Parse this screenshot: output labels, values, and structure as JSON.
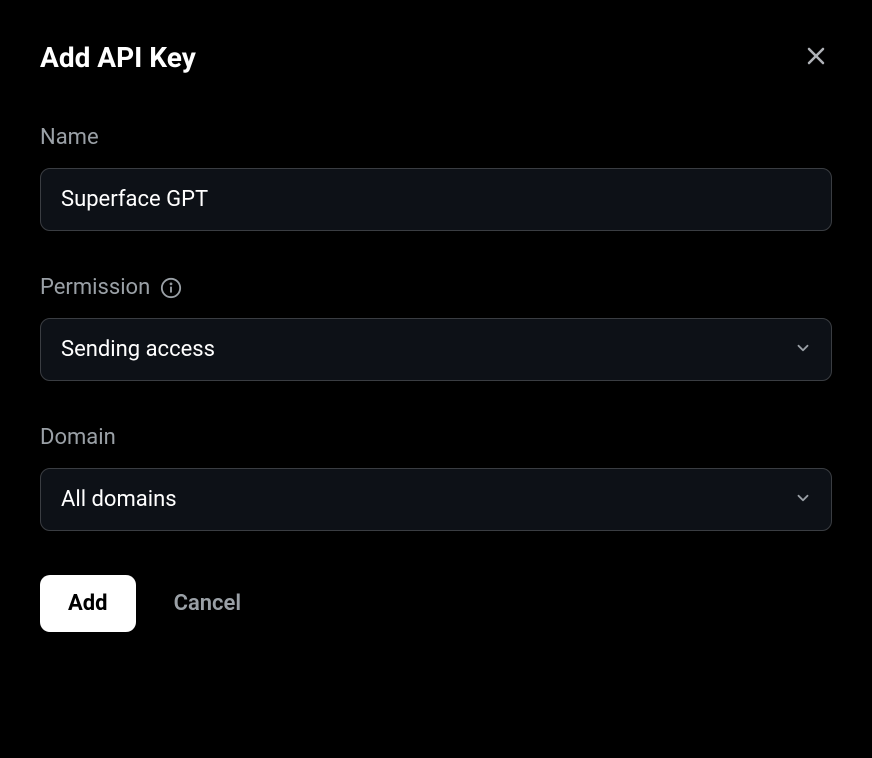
{
  "modal": {
    "title": "Add API Key"
  },
  "form": {
    "name": {
      "label": "Name",
      "value": "Superface GPT"
    },
    "permission": {
      "label": "Permission",
      "value": "Sending access"
    },
    "domain": {
      "label": "Domain",
      "value": "All domains"
    }
  },
  "buttons": {
    "add": "Add",
    "cancel": "Cancel"
  }
}
